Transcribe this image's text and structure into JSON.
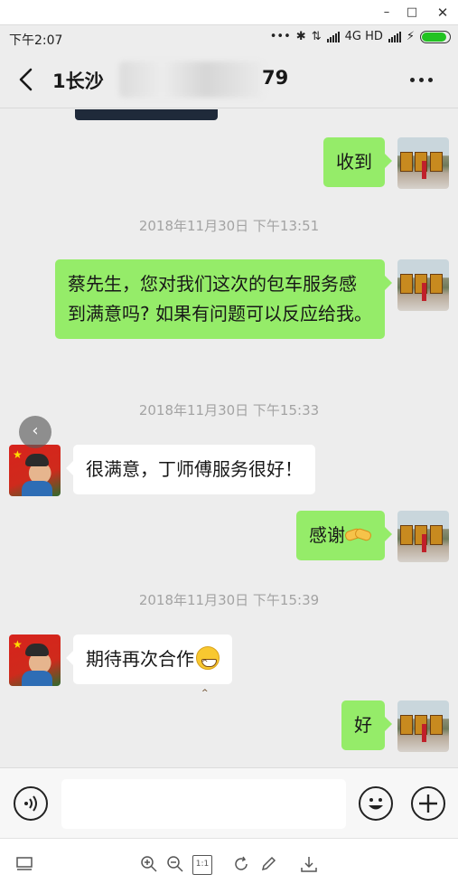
{
  "window": {
    "minimize": "–",
    "maximize": "□",
    "close": "✕"
  },
  "status_bar": {
    "time": "下午2:07",
    "dots": "•••",
    "bluetooth": "✱",
    "data_arrows": "⇅",
    "network": "4G HD",
    "charge": "⚡",
    "battery_level": 0.9
  },
  "header": {
    "back": "‹",
    "title_visible_prefix": "1长沙",
    "title_visible_suffix": "79",
    "title_obscured": true
  },
  "messages": [
    {
      "side": "right",
      "text": "收到",
      "avatar": "bus-avatar"
    },
    {
      "type": "time",
      "text": "2018年11月30日 下午13:51"
    },
    {
      "side": "right",
      "text": "蔡先生，您对我们这次的包车服务感到满意吗? 如果有问题可以反应给我。",
      "avatar": "bus-avatar"
    },
    {
      "type": "time",
      "text": "2018年11月30日 下午15:33"
    },
    {
      "side": "left",
      "text": "很满意，丁师傅服务很好！",
      "avatar": "person-avatar"
    },
    {
      "side": "right",
      "text": "感谢",
      "emoji": "handshake-icon",
      "avatar": "bus-avatar"
    },
    {
      "type": "time",
      "text": "2018年11月30日 下午15:39"
    },
    {
      "side": "left",
      "text": "期待再次合作",
      "emoji": "grin-icon",
      "avatar": "person-avatar"
    },
    {
      "side": "right",
      "text": "好",
      "avatar": "bus-avatar"
    }
  ],
  "input_bar": {
    "voice_icon": "voice-icon",
    "placeholder": "",
    "emoji_icon": "smiley-icon",
    "plus_icon": "plus-icon"
  },
  "viewer_toolbar": {
    "tools": [
      "layout-icon",
      "zoom-in-icon",
      "zoom-out-icon",
      "actual-size-icon",
      "rotate-icon",
      "edit-icon",
      "download-icon"
    ],
    "actual_size_label": "1:1"
  },
  "colors": {
    "green_bubble": "#95ec69",
    "white_bubble": "#ffffff",
    "background": "#ededed",
    "timestamp": "#a3a3a3"
  }
}
